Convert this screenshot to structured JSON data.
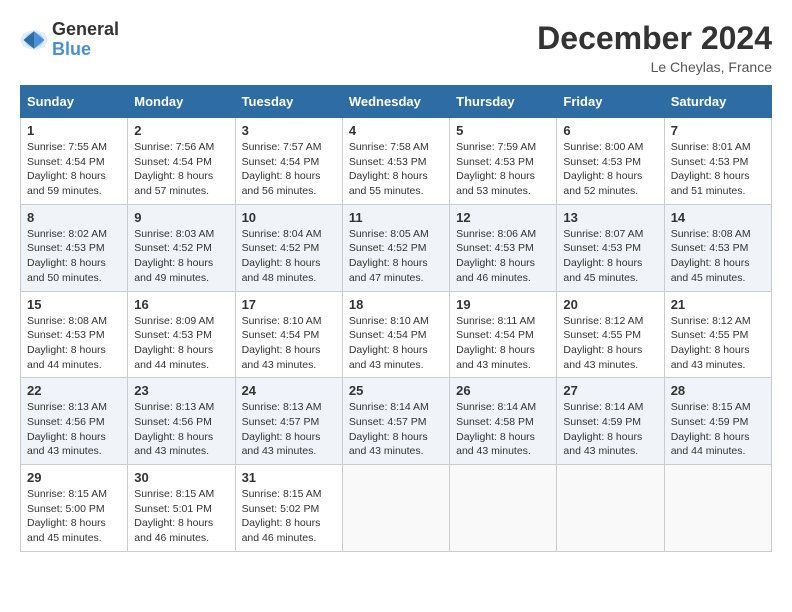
{
  "logo": {
    "general": "General",
    "blue": "Blue"
  },
  "title": "December 2024",
  "location": "Le Cheylas, France",
  "days_of_week": [
    "Sunday",
    "Monday",
    "Tuesday",
    "Wednesday",
    "Thursday",
    "Friday",
    "Saturday"
  ],
  "weeks": [
    [
      {
        "day": "1",
        "sunrise": "7:55 AM",
        "sunset": "4:54 PM",
        "daylight": "8 hours and 59 minutes."
      },
      {
        "day": "2",
        "sunrise": "7:56 AM",
        "sunset": "4:54 PM",
        "daylight": "8 hours and 57 minutes."
      },
      {
        "day": "3",
        "sunrise": "7:57 AM",
        "sunset": "4:54 PM",
        "daylight": "8 hours and 56 minutes."
      },
      {
        "day": "4",
        "sunrise": "7:58 AM",
        "sunset": "4:53 PM",
        "daylight": "8 hours and 55 minutes."
      },
      {
        "day": "5",
        "sunrise": "7:59 AM",
        "sunset": "4:53 PM",
        "daylight": "8 hours and 53 minutes."
      },
      {
        "day": "6",
        "sunrise": "8:00 AM",
        "sunset": "4:53 PM",
        "daylight": "8 hours and 52 minutes."
      },
      {
        "day": "7",
        "sunrise": "8:01 AM",
        "sunset": "4:53 PM",
        "daylight": "8 hours and 51 minutes."
      }
    ],
    [
      {
        "day": "8",
        "sunrise": "8:02 AM",
        "sunset": "4:53 PM",
        "daylight": "8 hours and 50 minutes."
      },
      {
        "day": "9",
        "sunrise": "8:03 AM",
        "sunset": "4:52 PM",
        "daylight": "8 hours and 49 minutes."
      },
      {
        "day": "10",
        "sunrise": "8:04 AM",
        "sunset": "4:52 PM",
        "daylight": "8 hours and 48 minutes."
      },
      {
        "day": "11",
        "sunrise": "8:05 AM",
        "sunset": "4:52 PM",
        "daylight": "8 hours and 47 minutes."
      },
      {
        "day": "12",
        "sunrise": "8:06 AM",
        "sunset": "4:53 PM",
        "daylight": "8 hours and 46 minutes."
      },
      {
        "day": "13",
        "sunrise": "8:07 AM",
        "sunset": "4:53 PM",
        "daylight": "8 hours and 45 minutes."
      },
      {
        "day": "14",
        "sunrise": "8:08 AM",
        "sunset": "4:53 PM",
        "daylight": "8 hours and 45 minutes."
      }
    ],
    [
      {
        "day": "15",
        "sunrise": "8:08 AM",
        "sunset": "4:53 PM",
        "daylight": "8 hours and 44 minutes."
      },
      {
        "day": "16",
        "sunrise": "8:09 AM",
        "sunset": "4:53 PM",
        "daylight": "8 hours and 44 minutes."
      },
      {
        "day": "17",
        "sunrise": "8:10 AM",
        "sunset": "4:54 PM",
        "daylight": "8 hours and 43 minutes."
      },
      {
        "day": "18",
        "sunrise": "8:10 AM",
        "sunset": "4:54 PM",
        "daylight": "8 hours and 43 minutes."
      },
      {
        "day": "19",
        "sunrise": "8:11 AM",
        "sunset": "4:54 PM",
        "daylight": "8 hours and 43 minutes."
      },
      {
        "day": "20",
        "sunrise": "8:12 AM",
        "sunset": "4:55 PM",
        "daylight": "8 hours and 43 minutes."
      },
      {
        "day": "21",
        "sunrise": "8:12 AM",
        "sunset": "4:55 PM",
        "daylight": "8 hours and 43 minutes."
      }
    ],
    [
      {
        "day": "22",
        "sunrise": "8:13 AM",
        "sunset": "4:56 PM",
        "daylight": "8 hours and 43 minutes."
      },
      {
        "day": "23",
        "sunrise": "8:13 AM",
        "sunset": "4:56 PM",
        "daylight": "8 hours and 43 minutes."
      },
      {
        "day": "24",
        "sunrise": "8:13 AM",
        "sunset": "4:57 PM",
        "daylight": "8 hours and 43 minutes."
      },
      {
        "day": "25",
        "sunrise": "8:14 AM",
        "sunset": "4:57 PM",
        "daylight": "8 hours and 43 minutes."
      },
      {
        "day": "26",
        "sunrise": "8:14 AM",
        "sunset": "4:58 PM",
        "daylight": "8 hours and 43 minutes."
      },
      {
        "day": "27",
        "sunrise": "8:14 AM",
        "sunset": "4:59 PM",
        "daylight": "8 hours and 43 minutes."
      },
      {
        "day": "28",
        "sunrise": "8:15 AM",
        "sunset": "4:59 PM",
        "daylight": "8 hours and 44 minutes."
      }
    ],
    [
      {
        "day": "29",
        "sunrise": "8:15 AM",
        "sunset": "5:00 PM",
        "daylight": "8 hours and 45 minutes."
      },
      {
        "day": "30",
        "sunrise": "8:15 AM",
        "sunset": "5:01 PM",
        "daylight": "8 hours and 46 minutes."
      },
      {
        "day": "31",
        "sunrise": "8:15 AM",
        "sunset": "5:02 PM",
        "daylight": "8 hours and 46 minutes."
      },
      null,
      null,
      null,
      null
    ]
  ]
}
